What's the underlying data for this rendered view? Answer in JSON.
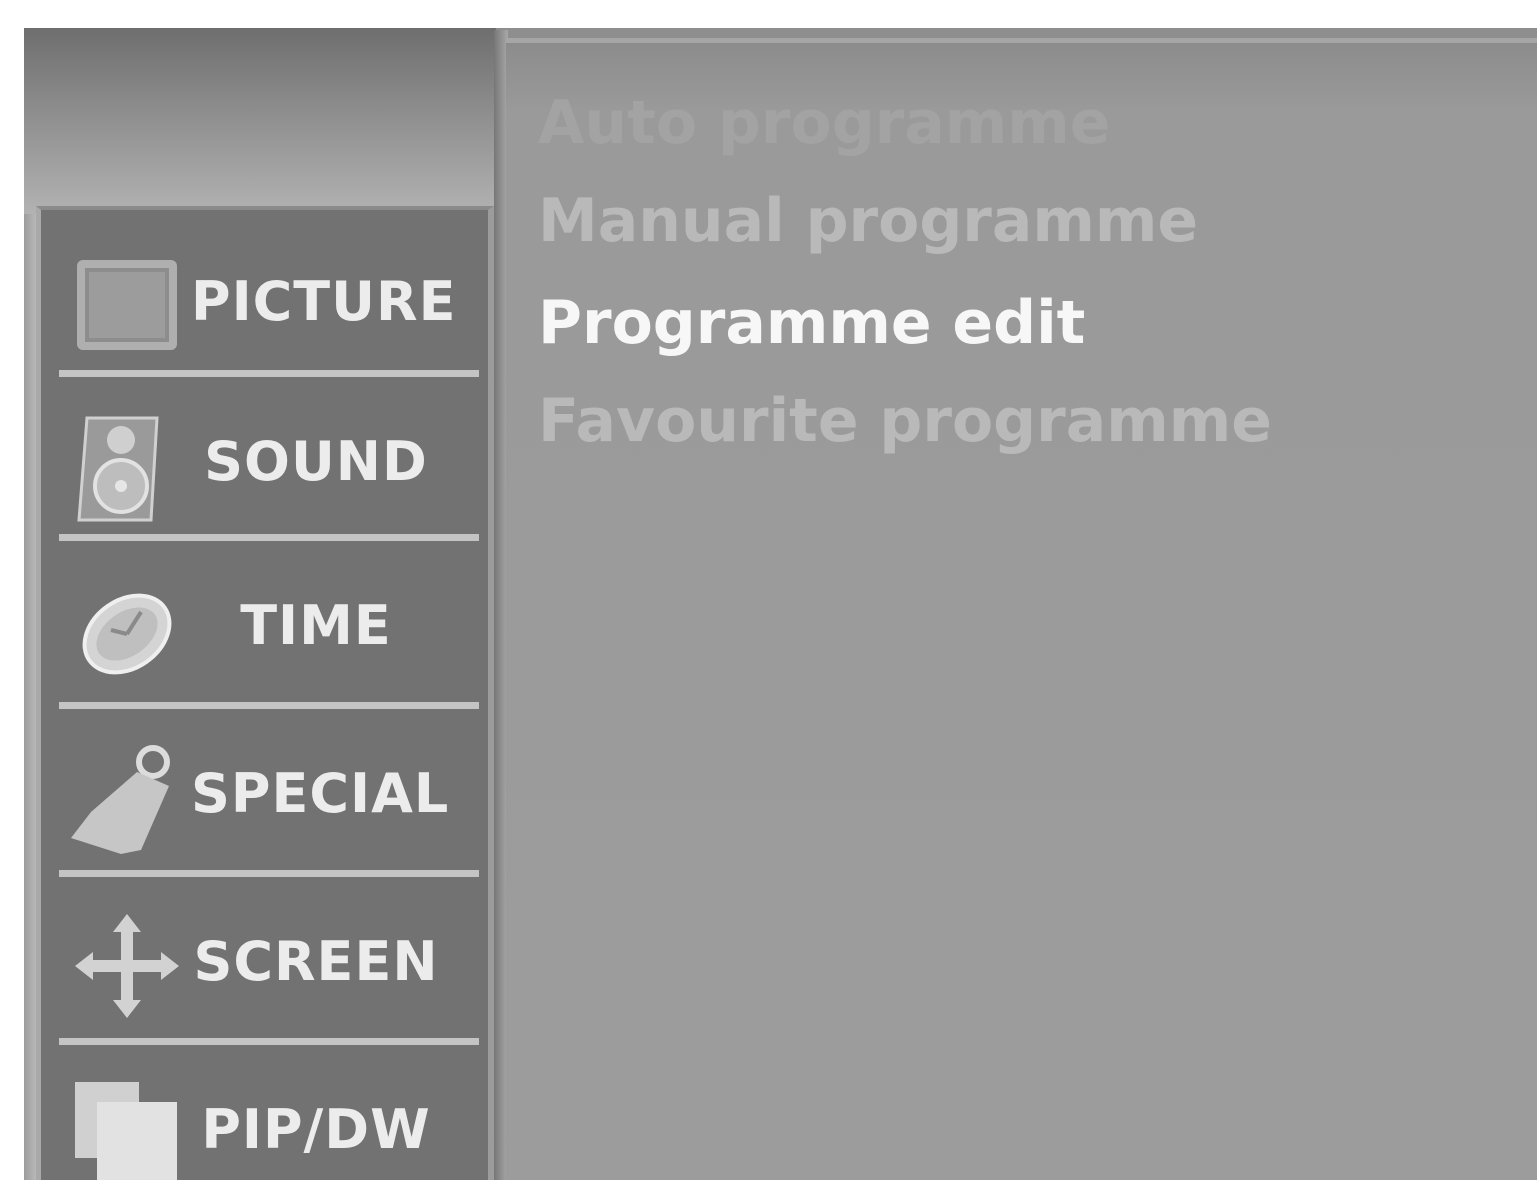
{
  "sidebar": {
    "items": [
      {
        "label": "PICTURE",
        "icon": "picture-icon"
      },
      {
        "label": "SOUND",
        "icon": "speaker-icon"
      },
      {
        "label": "TIME",
        "icon": "clock-icon"
      },
      {
        "label": "SPECIAL",
        "icon": "tag-icon"
      },
      {
        "label": "SCREEN",
        "icon": "move-arrows-icon"
      },
      {
        "label": "PIP/DW",
        "icon": "pip-windows-icon"
      }
    ]
  },
  "submenu": {
    "items": [
      {
        "label": "Auto programme",
        "state": "faded"
      },
      {
        "label": "Manual programme",
        "state": "dim"
      },
      {
        "label": "Programme edit",
        "state": "selected"
      },
      {
        "label": "Favourite programme",
        "state": "dim"
      }
    ]
  },
  "colors": {
    "frame": "#8e8e8e",
    "sidebar": "#727272",
    "divider": "#c4c4c4",
    "selected_text": "#f7f7f7",
    "dim_text": "#b9b9b9"
  }
}
